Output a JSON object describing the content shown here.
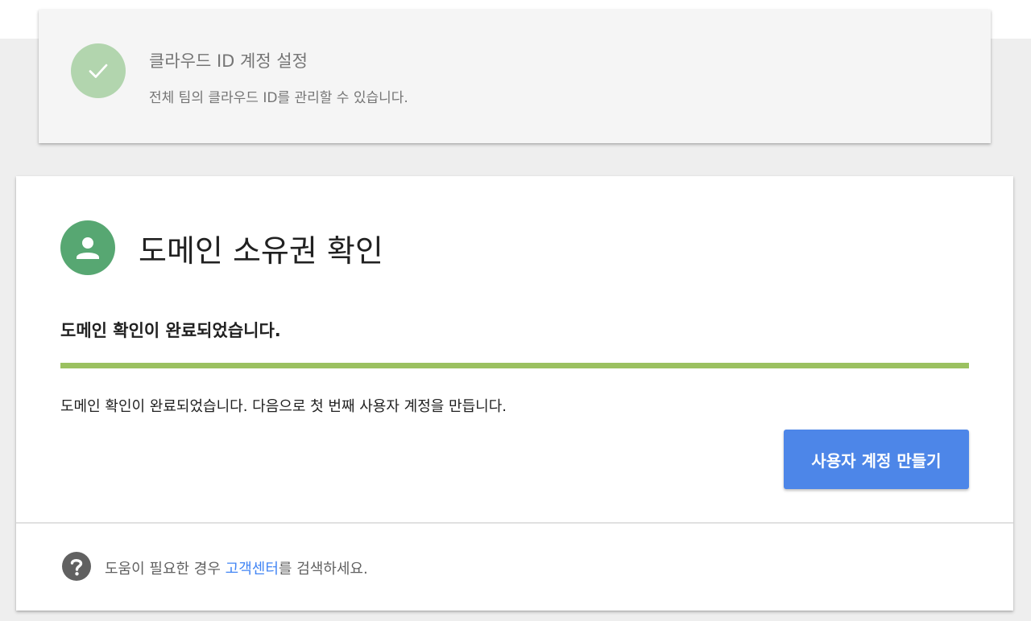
{
  "step": {
    "title": "클라우드 ID 계정 설정",
    "description": "전체 팀의 클라우드 ID를 관리할 수 있습니다.",
    "status": "completed"
  },
  "card": {
    "title": "도메인 소유권 확인",
    "status_heading": "도메인 확인이 완료되었습니다.",
    "progress": 1.0,
    "body": "도메인 확인이 완료되었습니다. 다음으로 첫 번째 사용자 계정을 만듭니다.",
    "primary_button": "사용자 계정 만들기"
  },
  "help": {
    "prefix": "도움이 필요한 경우 ",
    "link": "고객센터",
    "suffix": "를 검색하세요."
  },
  "colors": {
    "check_badge": "#b2d5ae",
    "avatar_badge": "#57a772",
    "progress_fill": "#9bc160",
    "primary_button": "#4d86e8",
    "link": "#4285f4"
  },
  "icons": {
    "step_badge": "check-icon",
    "card_badge": "person-icon",
    "help": "help-circle-icon"
  }
}
